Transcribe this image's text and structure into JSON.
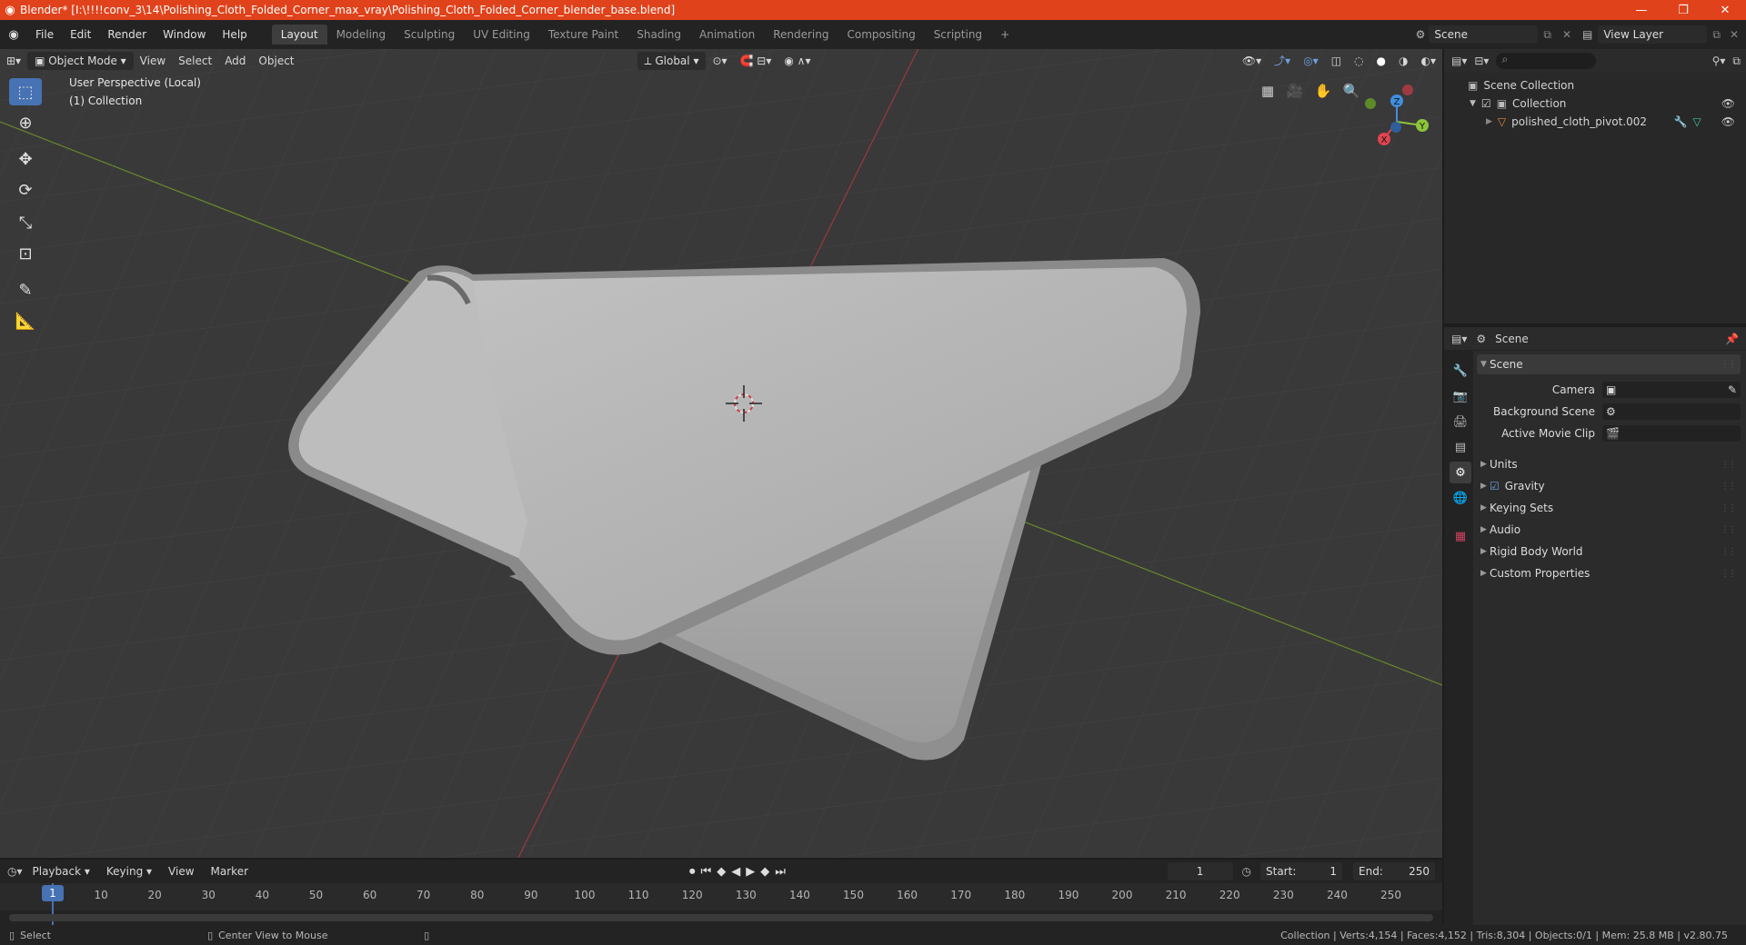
{
  "titlebar": {
    "title": "Blender* [I:\\!!!!conv_3\\14\\Polishing_Cloth_Folded_Corner_max_vray\\Polishing_Cloth_Folded_Corner_blender_base.blend]",
    "minimize": "—",
    "restore": "❐",
    "close": "✕"
  },
  "menu": [
    "File",
    "Edit",
    "Render",
    "Window",
    "Help"
  ],
  "workspaces": [
    "Layout",
    "Modeling",
    "Sculpting",
    "UV Editing",
    "Texture Paint",
    "Shading",
    "Animation",
    "Rendering",
    "Compositing",
    "Scripting"
  ],
  "add_workspace": "+",
  "scene_field": "Scene",
  "view_layer_field": "View Layer",
  "viewport": {
    "mode": "Object Mode",
    "menus": [
      "View",
      "Select",
      "Add",
      "Object"
    ],
    "orientation": "Global",
    "overlay_title": "User Perspective (Local)",
    "overlay_subtitle": "(1) Collection",
    "gizmo": {
      "x": "X",
      "y": "Y",
      "z": "Z"
    }
  },
  "outliner": {
    "root": "Scene Collection",
    "collection": "Collection",
    "object": "polished_cloth_pivot.002"
  },
  "properties": {
    "header": "Scene",
    "panel": "Scene",
    "camera_label": "Camera",
    "background_scene_label": "Background Scene",
    "active_movie_clip_label": "Active Movie Clip",
    "sections": [
      "Units",
      "Gravity",
      "Keying Sets",
      "Audio",
      "Rigid Body World",
      "Custom Properties"
    ]
  },
  "timeline": {
    "menus": [
      "Playback",
      "Keying",
      "View",
      "Marker"
    ],
    "current_frame": "1",
    "start_label": "Start:",
    "start_value": "1",
    "end_label": "End:",
    "end_value": "250",
    "ruler": [
      "1",
      "10",
      "20",
      "30",
      "40",
      "50",
      "60",
      "70",
      "80",
      "90",
      "100",
      "110",
      "120",
      "130",
      "140",
      "150",
      "160",
      "170",
      "180",
      "190",
      "200",
      "210",
      "220",
      "230",
      "240",
      "250"
    ]
  },
  "statusbar": {
    "left": "Select",
    "middle": "Center View to Mouse",
    "right": "Collection | Verts:4,154 | Faces:4,152 | Tris:8,304 | Objects:0/1 | Mem: 25.8 MB | v2.80.75"
  },
  "colors": {
    "titlebar": "#e0421b",
    "active_blue": "#4772b3",
    "viewport_bg": "#393939",
    "axis_x": "#e0444f",
    "axis_y": "#8cc43c",
    "axis_z": "#3f8fe0"
  }
}
